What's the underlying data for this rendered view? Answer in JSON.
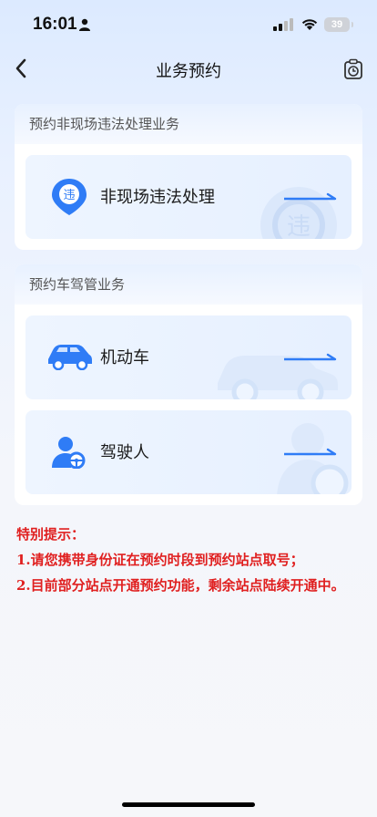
{
  "status_bar": {
    "time": "16:01",
    "battery": "39"
  },
  "nav": {
    "title": "业务预约",
    "back_icon": "chevron-left-icon",
    "history_icon": "clipboard-clock-icon"
  },
  "section_1": {
    "title": "预约非现场违法处理业务",
    "items": [
      {
        "label": "非现场违法处理",
        "icon": "violation-pin-icon"
      }
    ]
  },
  "section_2": {
    "title": "预约车驾管业务",
    "items": [
      {
        "label": "机动车",
        "icon": "car-icon"
      },
      {
        "label": "驾驶人",
        "icon": "driver-icon"
      }
    ]
  },
  "notice": {
    "heading": "特别提示：",
    "lines": [
      "1.请您携带身份证在预约时段到预约站点取号；",
      "2.目前部分站点开通预约功能，剩余站点陆续开通中。"
    ]
  },
  "colors": {
    "accent": "#2f7cf6",
    "notice": "#e02020"
  }
}
